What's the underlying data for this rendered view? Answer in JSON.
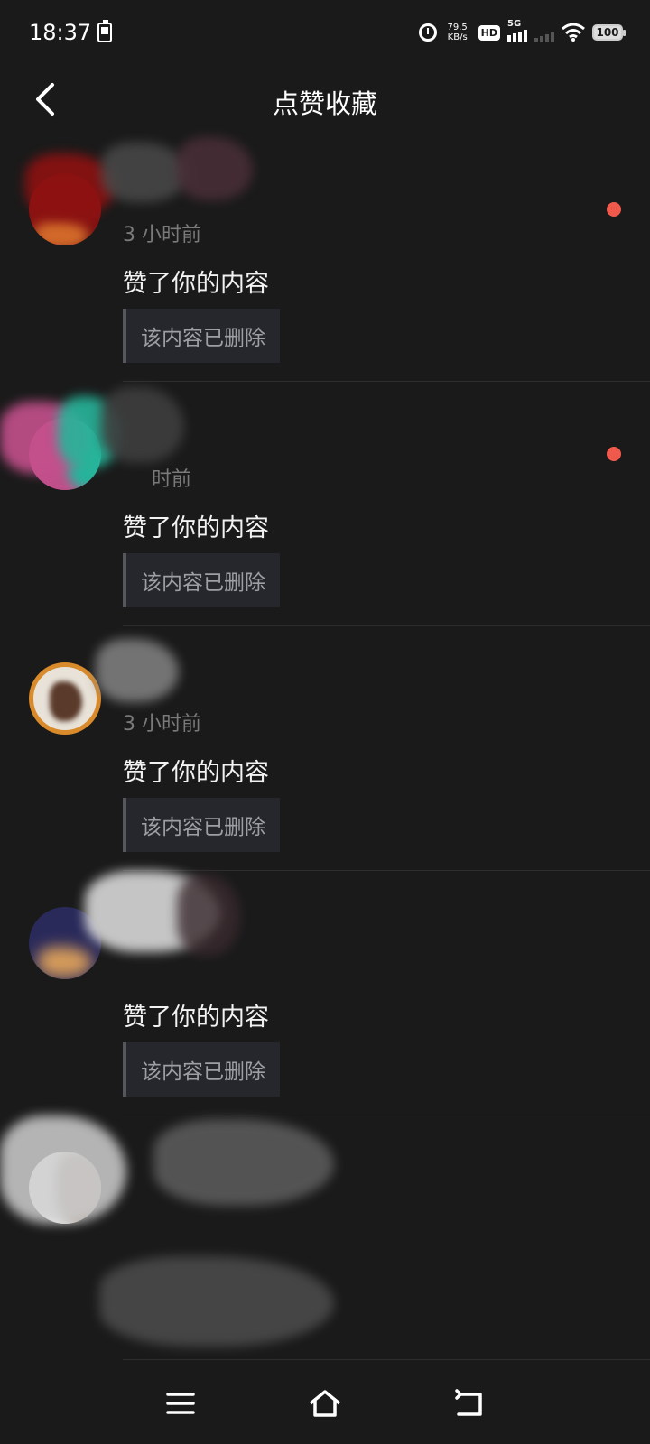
{
  "status": {
    "time": "18:37",
    "speed_value": "79.5",
    "speed_unit": "KB/s",
    "hd": "HD",
    "network": "5G",
    "battery": "100"
  },
  "header": {
    "title": "点赞收藏"
  },
  "items": [
    {
      "time": "3 小时前",
      "action": "赞了你的内容",
      "quote": "该内容已删除",
      "unread": true
    },
    {
      "time": "时前",
      "action": "赞了你的内容",
      "quote": "该内容已删除",
      "unread": true
    },
    {
      "time": "3 小时前",
      "action": "赞了你的内容",
      "quote": "该内容已删除",
      "unread": false
    },
    {
      "time": "",
      "action": "赞了你的内容",
      "quote": "该内容已删除",
      "unread": false
    },
    {
      "time": "",
      "action": "",
      "quote": "",
      "unread": false
    }
  ],
  "colors": {
    "background": "#1a1a1a",
    "unread": "#f05a4c",
    "quote_bg": "#25272c"
  },
  "icons": {
    "back": "chevron-left-icon",
    "menu": "menu-icon",
    "home": "home-icon",
    "return": "return-icon"
  }
}
